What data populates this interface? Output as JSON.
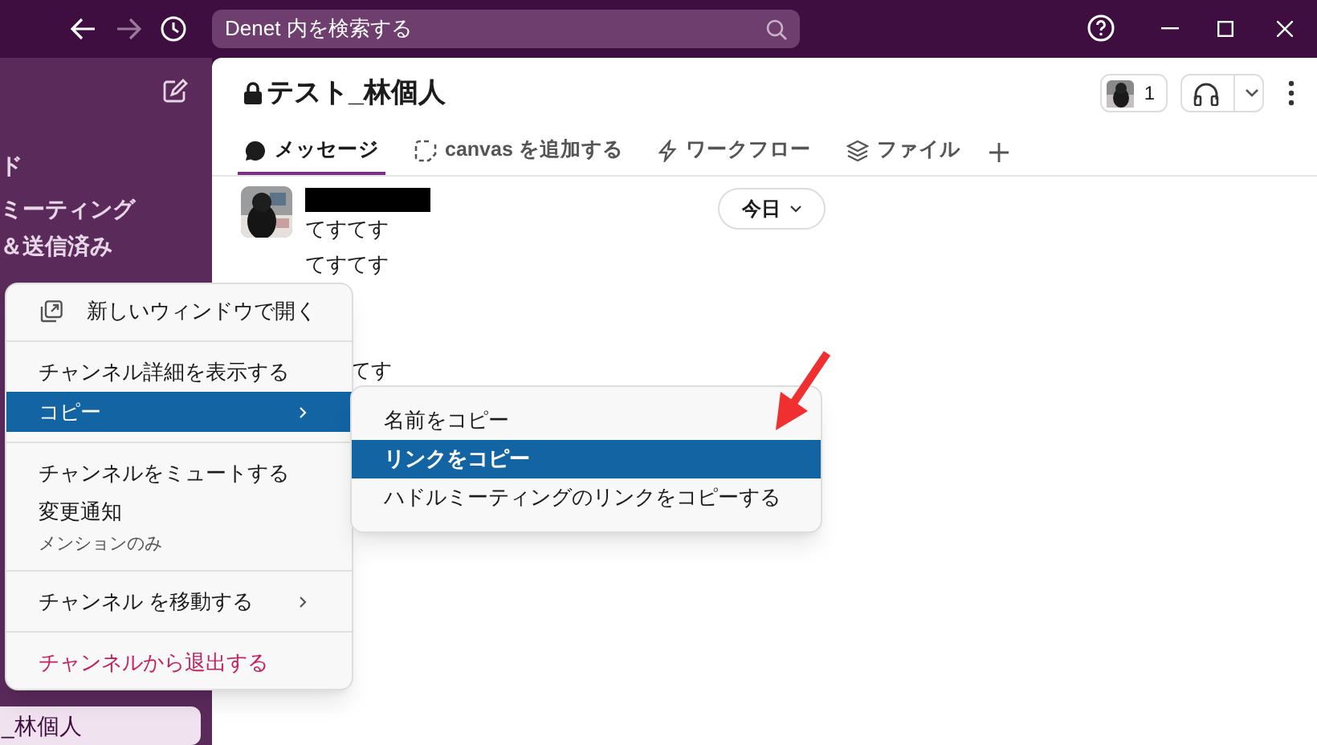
{
  "titlebar": {
    "search": {
      "placeholder": "Denet 内を検索する"
    }
  },
  "sidebar": {
    "items": [
      {
        "label": "ド",
        "selected": false
      },
      {
        "label": "ミーティング",
        "selected": false
      },
      {
        "label": "＆送信済み",
        "selected": false
      },
      {
        "label": "_林個人",
        "selected": true
      }
    ]
  },
  "channel": {
    "title": "テスト_林個人",
    "member_count": "1"
  },
  "tabs": [
    {
      "label": "メッセージ",
      "selected": true,
      "kind": "messages"
    },
    {
      "label": "canvas を追加する",
      "selected": false,
      "kind": "canvas"
    },
    {
      "label": "ワークフロー",
      "selected": false,
      "kind": "workflow"
    },
    {
      "label": "ファイル",
      "selected": false,
      "kind": "files"
    }
  ],
  "date_pill": "今日",
  "messages": [
    {
      "text": "てすてす",
      "kind": "full"
    },
    {
      "text": "てすてす",
      "kind": "full"
    },
    {
      "text": "てす",
      "kind": "partial"
    }
  ],
  "context_menu": {
    "sections": [
      [
        {
          "label": "新しいウィンドウで開く",
          "kind": "with-icon",
          "selected": false,
          "submenu": false
        }
      ],
      [
        {
          "label": "チャンネル詳細を表示する",
          "kind": "plain",
          "selected": false,
          "submenu": false
        },
        {
          "label": "コピー",
          "kind": "plain",
          "selected": true,
          "submenu": true
        }
      ],
      [
        {
          "label": "チャンネルをミュートする",
          "kind": "plain",
          "selected": false,
          "submenu": false
        },
        {
          "label": "変更通知",
          "sublabel": "メンションのみ",
          "kind": "plain",
          "selected": false,
          "submenu": false
        }
      ],
      [
        {
          "label": "チャンネル を移動する",
          "kind": "plain",
          "selected": false,
          "submenu": true
        }
      ],
      [
        {
          "label": "チャンネルから退出する",
          "kind": "danger",
          "selected": false,
          "submenu": false
        }
      ]
    ]
  },
  "submenu": {
    "items": [
      {
        "label": "名前をコピー",
        "selected": false
      },
      {
        "label": "リンクをコピー",
        "selected": true
      },
      {
        "label": "ハドルミーティングのリンクをコピーする",
        "selected": false
      }
    ]
  }
}
